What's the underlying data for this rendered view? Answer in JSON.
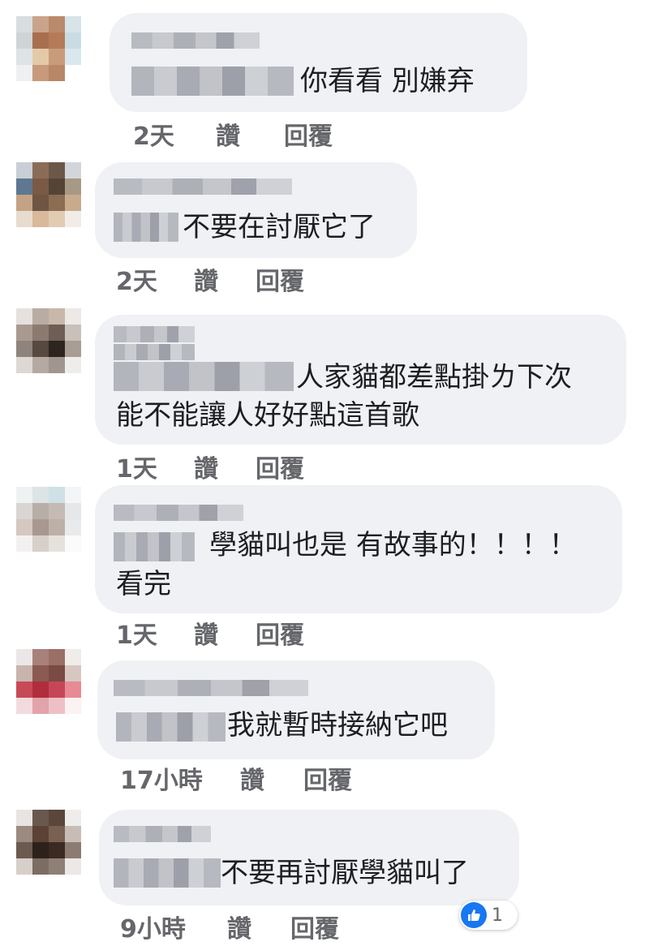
{
  "comments": [
    {
      "text_lines": [
        "你看看 別嫌弃"
      ],
      "time": "2天",
      "like_label": "讚",
      "reply_label": "回覆"
    },
    {
      "text_lines": [
        "不要在討厭它了"
      ],
      "time": "2天",
      "like_label": "讚",
      "reply_label": "回覆"
    },
    {
      "text_lines": [
        "人家貓都差點掛ㄌ下次",
        "能不能讓人好好點這首歌"
      ],
      "time": "1天",
      "like_label": "讚",
      "reply_label": "回覆"
    },
    {
      "text_lines": [
        "學貓叫也是 有故事的！！！！",
        "看完"
      ],
      "time": "1天",
      "like_label": "讚",
      "reply_label": "回覆"
    },
    {
      "text_lines": [
        "我就暫時接納它吧"
      ],
      "time": "17小時",
      "like_label": "讚",
      "reply_label": "回覆"
    },
    {
      "text_lines": [
        "不要再討厭學貓叫了"
      ],
      "time": "9小時",
      "like_label": "讚",
      "reply_label": "回覆",
      "reaction_count": "1"
    }
  ],
  "colors": {
    "bubble": "#f0f1f4",
    "like_blue": "#1877f2",
    "meta_gray": "#65676b"
  },
  "icons": {
    "reaction": "thumbs-up-icon"
  }
}
